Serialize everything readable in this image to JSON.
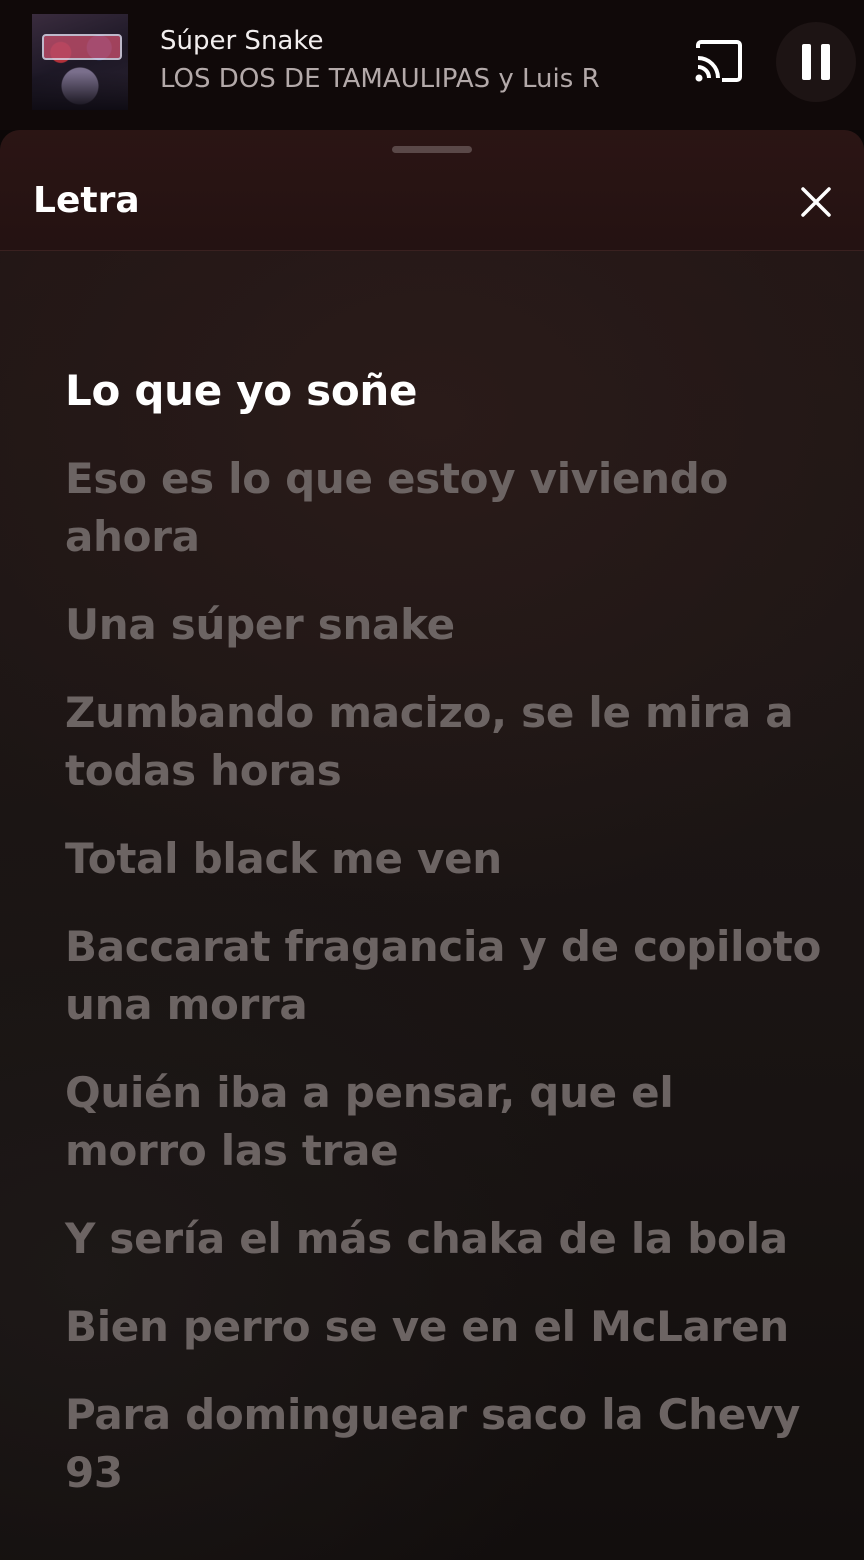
{
  "mini_player": {
    "album_art_icon": "album-cover-image",
    "track_title": "Súper Snake",
    "track_artist": "LOS DOS DE TAMAULIPAS y Luis R",
    "cast_icon": "cast-icon",
    "pause_icon": "pause-icon"
  },
  "lyrics_sheet": {
    "title": "Letra",
    "close_icon": "close-icon",
    "active_index": 0,
    "lines": [
      "Lo que yo soñe",
      "Eso es lo que estoy viviendo ahora",
      "Una súper snake",
      "Zumbando macizo, se le mira a todas horas",
      "Total black me ven",
      "Baccarat fragancia y de copiloto una morra",
      "Quién iba a pensar, que el morro las trae",
      "Y sería el más chaka de la bola",
      "Bien perro se ve en el McLaren",
      "Para dominguear saco la Chevy 93"
    ]
  },
  "colors": {
    "active_lyric": "#ffffff",
    "inactive_lyric": "#6c6463",
    "header_bg": "#2b1514"
  }
}
